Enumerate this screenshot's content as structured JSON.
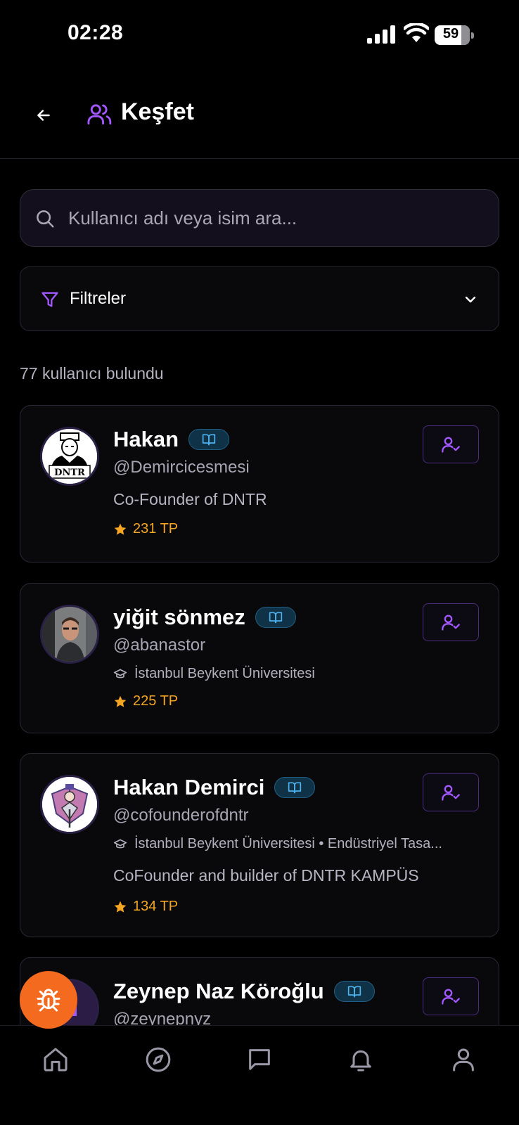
{
  "status_bar": {
    "time": "02:28",
    "battery": "59"
  },
  "header": {
    "title": "Keşfet"
  },
  "search": {
    "placeholder": "Kullanıcı adı veya isim ara..."
  },
  "filters": {
    "label": "Filtreler"
  },
  "result_count": "77 kullanıcı bulundu",
  "users": [
    {
      "name": "Hakan",
      "handle": "@Demircicesmesi",
      "bio": "Co-Founder of DNTR",
      "tp": "231 TP",
      "avatar_text": "DNTR"
    },
    {
      "name": "yiğit sönmez",
      "handle": "@abanastor",
      "school": "İstanbul Beykent Üniversitesi",
      "tp": "225 TP"
    },
    {
      "name": "Hakan Demirci",
      "handle": "@cofounderofdntr",
      "school": "İstanbul Beykent Üniversitesi • Endüstriyel Tasa...",
      "bio": "CoFounder and builder of DNTR KAMPÜS",
      "tp": "134 TP"
    },
    {
      "name": "Zeynep Naz Köroğlu",
      "handle": "@zeynepnyz",
      "avatar_text": "N"
    }
  ],
  "colors": {
    "accent": "#a259ff",
    "star": "#f4a623",
    "fab": "#f46a1f",
    "badge": "#0f3247"
  },
  "icons": {
    "back": "arrow-left-icon",
    "users": "users-icon",
    "search": "search-icon",
    "filter": "filter-icon",
    "chevron": "chevron-down-icon",
    "badge": "book-open-icon",
    "follow": "user-check-icon",
    "star": "star-icon",
    "school": "graduation-cap-icon",
    "fab": "bug-icon",
    "nav": [
      "home-icon",
      "compass-icon",
      "message-icon",
      "bell-icon",
      "user-icon"
    ]
  }
}
